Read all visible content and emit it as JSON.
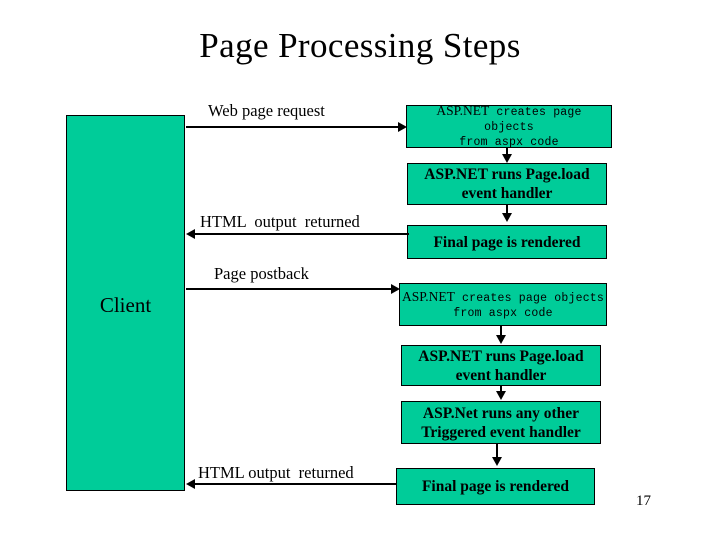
{
  "slide": {
    "title": "Page Processing Steps",
    "page_number": "17",
    "accent_green": "#00CC99",
    "line_color": "#000000",
    "background": "#FFFFFF"
  },
  "client": {
    "label": "Client"
  },
  "flow_labels": {
    "web_page_request": "Web page request",
    "html_output_returned_1": "HTML  output  returned",
    "page_postback": "Page postback",
    "html_output_returned_2": "HTML output  returned"
  },
  "boxes": [
    {
      "id": "box-create-1",
      "line1_emphasis": "ASP.NET",
      "line1_rest": " creates page objects",
      "line2": "from aspx code",
      "style": "mono"
    },
    {
      "id": "box-pageload-1",
      "line1": "ASP.NET runs Page.load",
      "line2": "event handler",
      "style": "serif"
    },
    {
      "id": "box-final-1",
      "line1": "Final page is rendered",
      "style": "serif"
    },
    {
      "id": "box-create-2",
      "line1_emphasis": "ASP.NET",
      "line1_rest": " creates page objects",
      "line2": "from aspx code",
      "style": "mono"
    },
    {
      "id": "box-pageload-2",
      "line1": "ASP.NET runs Page.load",
      "line2": "event handler",
      "style": "serif"
    },
    {
      "id": "box-other-2",
      "line1": "ASP.Net runs any other",
      "line2": "Triggered event handler",
      "style": "serif"
    },
    {
      "id": "box-final-2",
      "line1": "Final page is rendered",
      "style": "serif"
    }
  ]
}
